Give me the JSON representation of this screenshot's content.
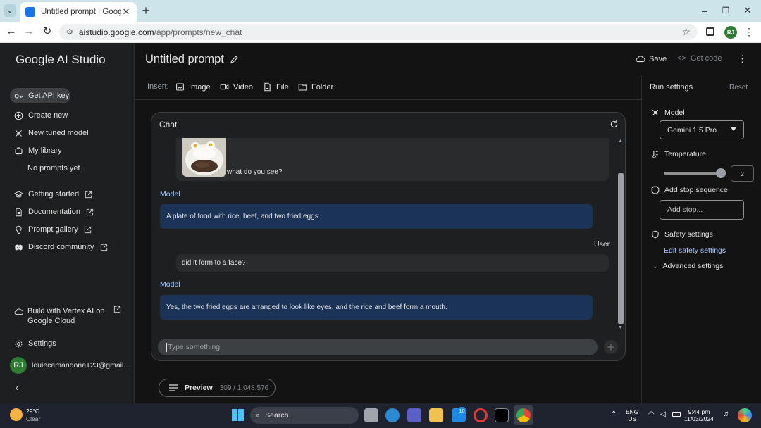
{
  "browser": {
    "tab_title": "Untitled prompt | Google AI Stu",
    "url_host": "aistudio.google.com",
    "url_path": "/app/prompts/new_chat",
    "profile_initials": "RJ"
  },
  "sidebar": {
    "brand": "Google AI Studio",
    "api_key_label": "Get API key",
    "items": [
      {
        "label": "Create new",
        "icon": "plus-circle-icon"
      },
      {
        "label": "New tuned model",
        "icon": "tune-icon"
      },
      {
        "label": "My library",
        "icon": "library-icon"
      }
    ],
    "no_prompts": "No prompts yet",
    "links": [
      {
        "label": "Getting started",
        "icon": "school-icon"
      },
      {
        "label": "Documentation",
        "icon": "doc-icon"
      },
      {
        "label": "Prompt gallery",
        "icon": "bulb-icon"
      },
      {
        "label": "Discord community",
        "icon": "discord-icon"
      }
    ],
    "vertex_line1": "Build with Vertex AI on",
    "vertex_line2": "Google Cloud",
    "settings": "Settings",
    "account_initials": "RJ",
    "account_email": "louiecamandona123@gmail..."
  },
  "header": {
    "title": "Untitled prompt",
    "save": "Save",
    "get_code": "Get code"
  },
  "insert": {
    "label": "Insert:",
    "items": [
      "Image",
      "Video",
      "File",
      "Folder"
    ]
  },
  "chat": {
    "title": "Chat",
    "first_user_text": "what do you see?",
    "model_role": "Model",
    "user_role": "User",
    "model_reply_1": "A plate of food with rice, beef, and two fried eggs.",
    "user_msg_2": "did it form to a face?",
    "model_reply_2": "Yes, the two fried eggs are arranged to look like eyes, and the rice and beef form a mouth.",
    "input_placeholder": "Type something"
  },
  "preview": {
    "label": "Preview",
    "token_count": "309 / 1,048,576"
  },
  "run_settings": {
    "title": "Run settings",
    "reset": "Reset",
    "model_label": "Model",
    "model_value": "Gemini 1.5 Pro",
    "temperature_label": "Temperature",
    "temperature_value": "2",
    "temperature_fraction": 1.0,
    "stop_label": "Add stop sequence",
    "stop_placeholder": "Add stop...",
    "safety_label": "Safety settings",
    "safety_link": "Edit safety settings",
    "advanced": "Advanced settings"
  },
  "taskbar": {
    "weather_temp": "29°C",
    "weather_desc": "Clear",
    "search": "Search",
    "lang1": "ENG",
    "lang2": "US",
    "time": "9:44 pm",
    "date": "11/03/2024",
    "badge": "10"
  },
  "colors": {
    "accent_blue": "#a8c7fa",
    "model_bubble": "#1c3358",
    "avatar_green": "#2e7d32"
  }
}
